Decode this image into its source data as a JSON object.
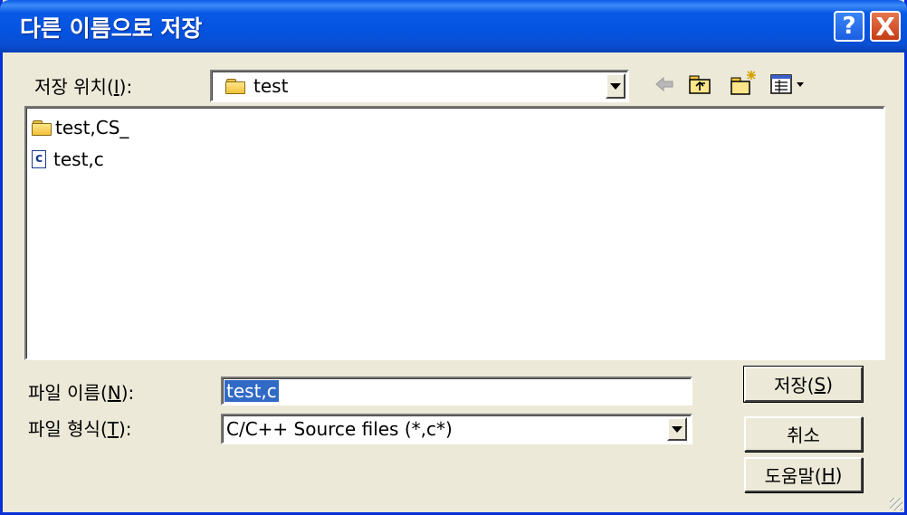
{
  "window": {
    "title": "다른 이름으로 저장",
    "help_label": "?",
    "close_label": "X"
  },
  "save_in": {
    "label_prefix": "저장 위치(",
    "label_accel": "I",
    "label_suffix": "):",
    "value": "test"
  },
  "files": [
    {
      "name": "test,CS_",
      "type": "folder"
    },
    {
      "name": "test,c",
      "type": "c-file"
    }
  ],
  "file_name": {
    "label_prefix": "파일 이름(",
    "label_accel": "N",
    "label_suffix": "):",
    "value": "test,c"
  },
  "file_type": {
    "label_prefix": "파일 형식(",
    "label_accel": "T",
    "label_suffix": "):",
    "value": "C/C++ Source files (*,c*)"
  },
  "buttons": {
    "save_prefix": "저장(",
    "save_accel": "S",
    "save_suffix": ")",
    "cancel": "취소",
    "help_prefix": "도움말(",
    "help_accel": "H",
    "help_suffix": ")"
  },
  "c_icon_letter": "c",
  "icons": [
    "folder-icon",
    "back-arrow-icon",
    "up-folder-icon",
    "new-folder-icon",
    "view-menu-icon",
    "c-file-icon"
  ],
  "colors": {
    "title_bar": "#0453e0",
    "selection": "#316ac5",
    "close": "#c43b13",
    "face": "#ece9d8"
  }
}
